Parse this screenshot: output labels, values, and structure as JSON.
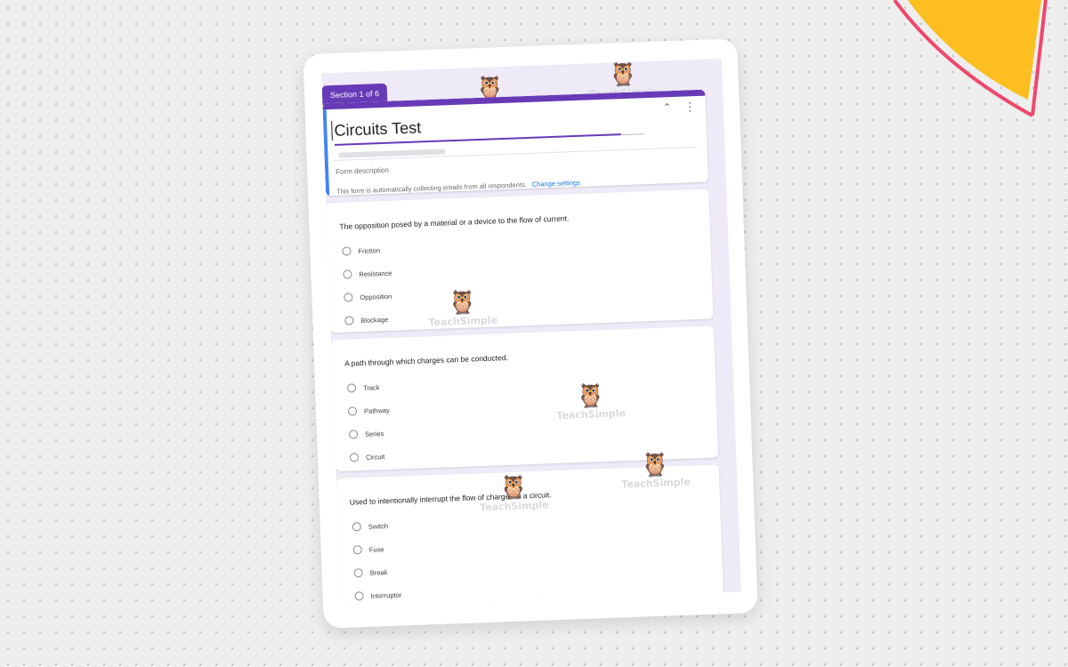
{
  "decor": {
    "accent_yellow": "#fdbf1f",
    "accent_pink": "#f0476c",
    "background": "#eeeeee"
  },
  "form": {
    "section_label": "Section 1 of 6",
    "title": "Circuits Test",
    "description_placeholder": "Form description",
    "email_note": "This form is automatically collecting emails from all respondents.",
    "change_settings": "Change settings",
    "theme_color": "#673ab7",
    "icons": {
      "collapse": "collapse-icon",
      "more": "more-vert-icon"
    }
  },
  "questions": [
    {
      "text": "The opposition posed by a material or a device to the flow of current.",
      "options": [
        "Friction",
        "Resistance",
        "Opposition",
        "Blockage"
      ]
    },
    {
      "text": "A path through which charges can be conducted.",
      "options": [
        "Track",
        "Pathway",
        "Series",
        "Circuit"
      ]
    },
    {
      "text": "Used to intentionally interrupt the flow of charges in a circuit.",
      "options": [
        "Switch",
        "Fuse",
        "Break",
        "Interruptor"
      ]
    }
  ],
  "watermark": {
    "text": "TeachSimple"
  }
}
